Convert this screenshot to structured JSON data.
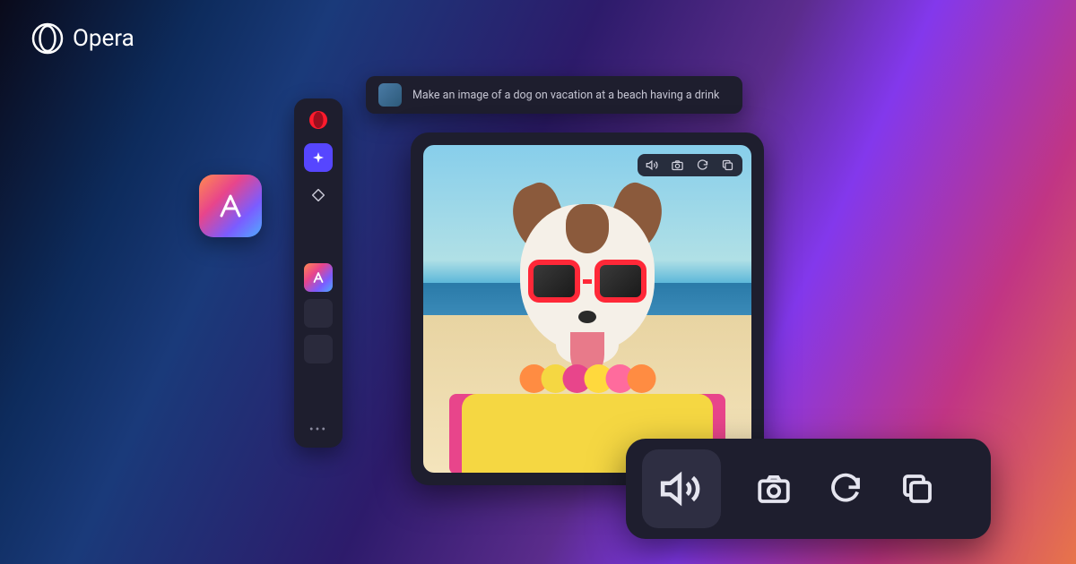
{
  "brand": {
    "name": "Opera"
  },
  "prompt": {
    "text": "Make an image of a dog on vacation at a beach having a drink"
  },
  "sidebar": {
    "apps_icon": "⋯"
  },
  "image_toolbar": {
    "items": [
      "speaker",
      "camera",
      "refresh",
      "copy"
    ]
  },
  "large_toolbar": {
    "items": [
      "speaker",
      "camera",
      "refresh",
      "copy"
    ],
    "active_index": 0
  },
  "lei_colors": [
    "#ff8c42",
    "#f5d742",
    "#e8458b",
    "#ffd93d",
    "#ff6b9d",
    "#ff8c42"
  ]
}
